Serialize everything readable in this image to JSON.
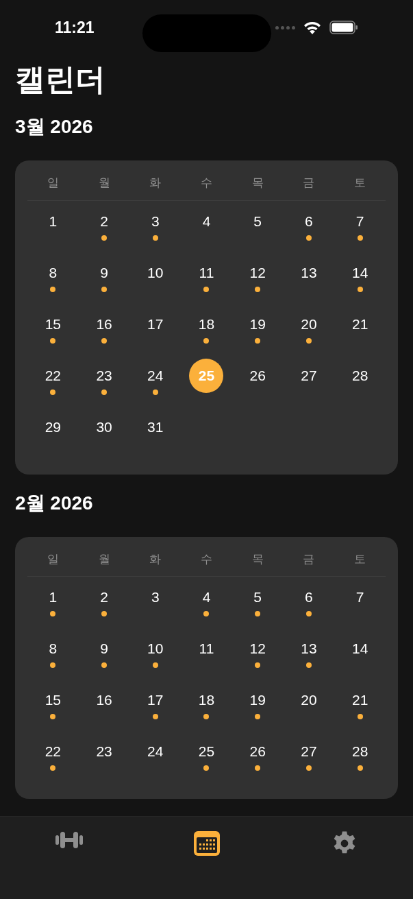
{
  "status_bar": {
    "time": "11:21"
  },
  "title": "캘린더",
  "months": [
    {
      "label": "3월 2026",
      "weekdays": [
        "일",
        "월",
        "화",
        "수",
        "목",
        "금",
        "토"
      ],
      "days": [
        {
          "day": "1",
          "marked": false,
          "selected": false
        },
        {
          "day": "2",
          "marked": true,
          "selected": false
        },
        {
          "day": "3",
          "marked": true,
          "selected": false
        },
        {
          "day": "4",
          "marked": false,
          "selected": false
        },
        {
          "day": "5",
          "marked": false,
          "selected": false
        },
        {
          "day": "6",
          "marked": true,
          "selected": false
        },
        {
          "day": "7",
          "marked": true,
          "selected": false
        },
        {
          "day": "8",
          "marked": true,
          "selected": false
        },
        {
          "day": "9",
          "marked": true,
          "selected": false
        },
        {
          "day": "10",
          "marked": false,
          "selected": false
        },
        {
          "day": "11",
          "marked": true,
          "selected": false
        },
        {
          "day": "12",
          "marked": true,
          "selected": false
        },
        {
          "day": "13",
          "marked": false,
          "selected": false
        },
        {
          "day": "14",
          "marked": true,
          "selected": false
        },
        {
          "day": "15",
          "marked": true,
          "selected": false
        },
        {
          "day": "16",
          "marked": true,
          "selected": false
        },
        {
          "day": "17",
          "marked": false,
          "selected": false
        },
        {
          "day": "18",
          "marked": true,
          "selected": false
        },
        {
          "day": "19",
          "marked": true,
          "selected": false
        },
        {
          "day": "20",
          "marked": true,
          "selected": false
        },
        {
          "day": "21",
          "marked": false,
          "selected": false
        },
        {
          "day": "22",
          "marked": true,
          "selected": false
        },
        {
          "day": "23",
          "marked": true,
          "selected": false
        },
        {
          "day": "24",
          "marked": true,
          "selected": false
        },
        {
          "day": "25",
          "marked": false,
          "selected": true
        },
        {
          "day": "26",
          "marked": false,
          "selected": false
        },
        {
          "day": "27",
          "marked": false,
          "selected": false
        },
        {
          "day": "28",
          "marked": false,
          "selected": false
        },
        {
          "day": "29",
          "marked": false,
          "selected": false
        },
        {
          "day": "30",
          "marked": false,
          "selected": false
        },
        {
          "day": "31",
          "marked": false,
          "selected": false
        }
      ]
    },
    {
      "label": "2월 2026",
      "weekdays": [
        "일",
        "월",
        "화",
        "수",
        "목",
        "금",
        "토"
      ],
      "days": [
        {
          "day": "1",
          "marked": true,
          "selected": false
        },
        {
          "day": "2",
          "marked": true,
          "selected": false
        },
        {
          "day": "3",
          "marked": false,
          "selected": false
        },
        {
          "day": "4",
          "marked": true,
          "selected": false
        },
        {
          "day": "5",
          "marked": true,
          "selected": false
        },
        {
          "day": "6",
          "marked": true,
          "selected": false
        },
        {
          "day": "7",
          "marked": false,
          "selected": false
        },
        {
          "day": "8",
          "marked": true,
          "selected": false
        },
        {
          "day": "9",
          "marked": true,
          "selected": false
        },
        {
          "day": "10",
          "marked": true,
          "selected": false
        },
        {
          "day": "11",
          "marked": false,
          "selected": false
        },
        {
          "day": "12",
          "marked": true,
          "selected": false
        },
        {
          "day": "13",
          "marked": true,
          "selected": false
        },
        {
          "day": "14",
          "marked": false,
          "selected": false
        },
        {
          "day": "15",
          "marked": true,
          "selected": false
        },
        {
          "day": "16",
          "marked": false,
          "selected": false
        },
        {
          "day": "17",
          "marked": true,
          "selected": false
        },
        {
          "day": "18",
          "marked": true,
          "selected": false
        },
        {
          "day": "19",
          "marked": true,
          "selected": false
        },
        {
          "day": "20",
          "marked": false,
          "selected": false
        },
        {
          "day": "21",
          "marked": true,
          "selected": false
        },
        {
          "day": "22",
          "marked": true,
          "selected": false
        },
        {
          "day": "23",
          "marked": false,
          "selected": false
        },
        {
          "day": "24",
          "marked": false,
          "selected": false
        },
        {
          "day": "25",
          "marked": true,
          "selected": false
        },
        {
          "day": "26",
          "marked": true,
          "selected": false
        },
        {
          "day": "27",
          "marked": true,
          "selected": false
        },
        {
          "day": "28",
          "marked": true,
          "selected": false
        }
      ]
    }
  ],
  "tabs": [
    {
      "kind": "dumbbell",
      "selected": false
    },
    {
      "kind": "calendar",
      "selected": true
    },
    {
      "kind": "gear",
      "selected": false
    }
  ]
}
